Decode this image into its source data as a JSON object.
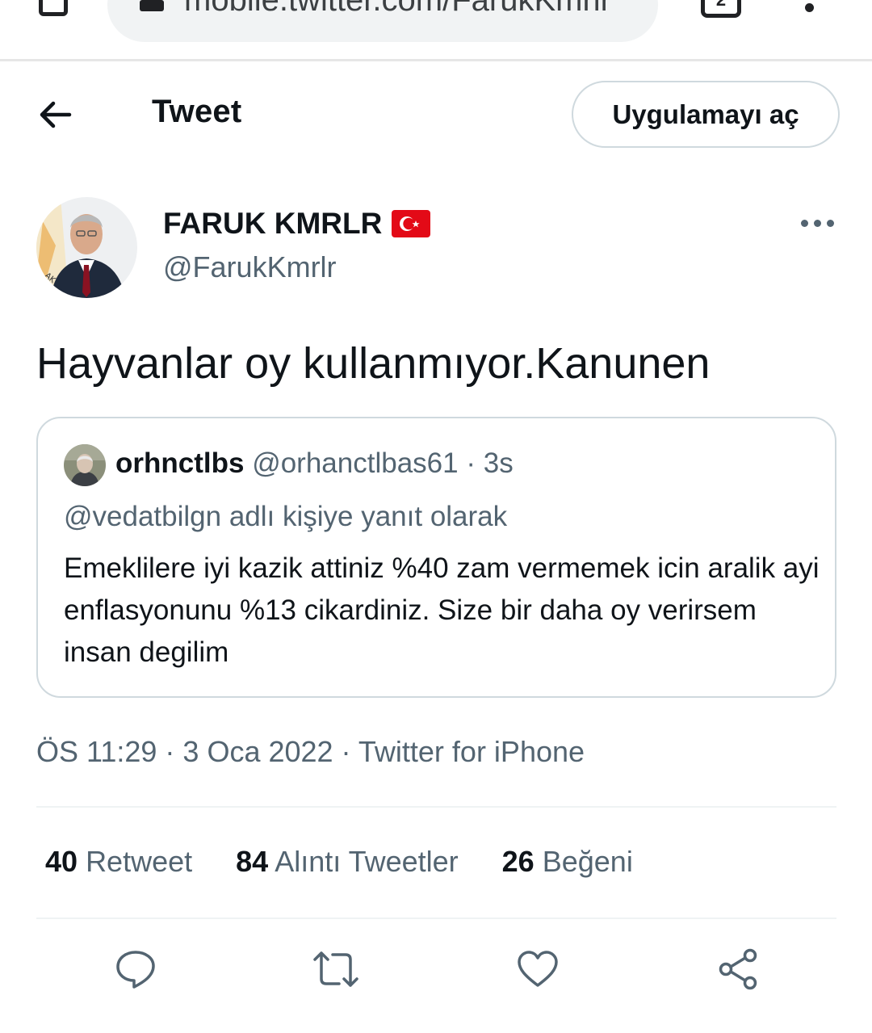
{
  "browser": {
    "url": "mobile.twitter.com/FarukKmrlr",
    "tab_count": "2"
  },
  "header": {
    "title": "Tweet",
    "open_app_label": "Uygulamayı aç"
  },
  "tweet": {
    "author_name": "FARUK KMRLR",
    "author_handle": "@FarukKmrlr",
    "text": "Hayvanlar oy kullanmıyor.Kanunen",
    "quote": {
      "name": "orhnctlbs",
      "handle": "@orhanctlbas61",
      "time": "· 3s",
      "reply_to": "@vedatbilgn adlı kişiye yanıt olarak",
      "body": "Emeklilere iyi kazik attiniz %40 zam vermemek icin aralik ayi enflasyonunu %13 cikardiniz. Size bir daha oy verirsem insan degilim"
    },
    "meta": "ÖS 11:29 · 3 Oca 2022 · Twitter for iPhone"
  },
  "stats": {
    "retweets": {
      "count": "40",
      "label": "Retweet"
    },
    "quotes": {
      "count": "84",
      "label": "Alıntı Tweetler"
    },
    "likes": {
      "count": "26",
      "label": "Beğeni"
    }
  },
  "icons": {
    "back": "arrow-left-icon",
    "reply": "reply-icon",
    "retweet": "retweet-icon",
    "like": "heart-icon",
    "share": "share-icon"
  },
  "colors": {
    "text_primary": "#0f1419",
    "text_secondary": "#536471",
    "border": "#cfd9de",
    "flag_red": "#e30a17"
  }
}
